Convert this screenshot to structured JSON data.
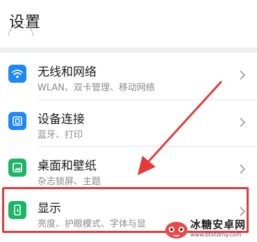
{
  "header": {
    "title": "设置"
  },
  "items": [
    {
      "title": "无线和网络",
      "subtitle": "WLAN、双卡管理、移动网络",
      "icon": "wifi-icon",
      "icon_color": "#1e88f5"
    },
    {
      "title": "设备连接",
      "subtitle": "蓝牙、打印",
      "icon": "device-connect-icon",
      "icon_color": "#1e88f5"
    },
    {
      "title": "桌面和壁纸",
      "subtitle": "杂志锁屏、主题",
      "icon": "wallpaper-icon",
      "icon_color": "#1bb567"
    },
    {
      "title": "显示",
      "subtitle": "亮度、护眼模式、字体与显",
      "icon": "display-icon",
      "icon_color": "#1bb567"
    }
  ],
  "annotation": {
    "highlight_color": "#e23a3a"
  },
  "watermark": {
    "name": "冰糖安卓网",
    "url": "www.btxtdmy.com"
  }
}
